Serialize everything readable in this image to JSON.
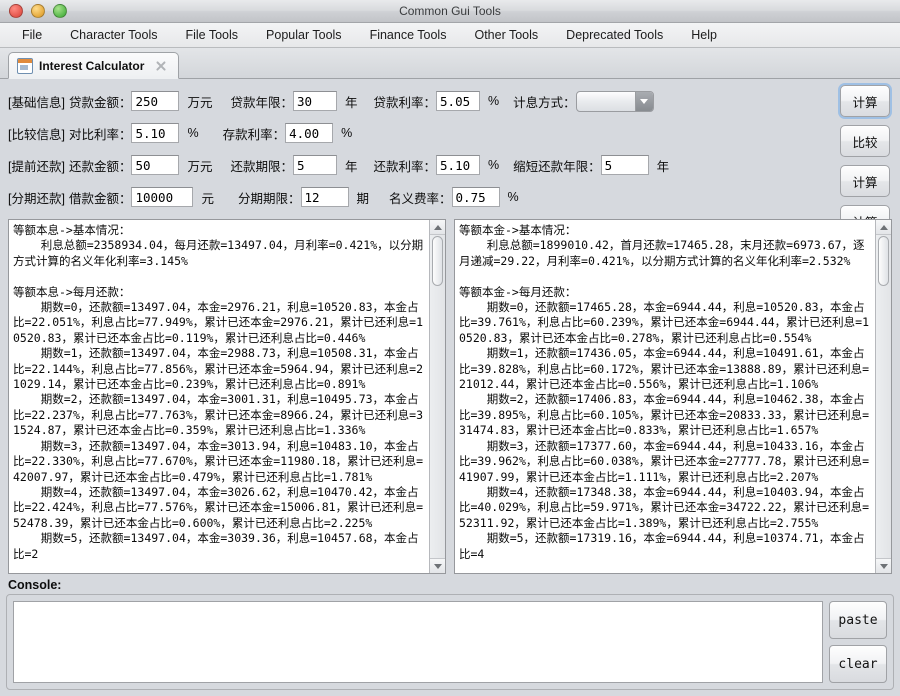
{
  "window": {
    "title": "Common Gui Tools"
  },
  "menubar": {
    "items": [
      "File",
      "Character Tools",
      "File Tools",
      "Popular Tools",
      "Finance Tools",
      "Other Tools",
      "Deprecated Tools",
      "Help"
    ]
  },
  "tabs": [
    {
      "label": "Interest Calculator",
      "icon": "calendar-icon",
      "close": "close-icon"
    }
  ],
  "form": {
    "row1": {
      "group": "[基础信息]",
      "f1_label": "贷款金额：",
      "f1_value": "250",
      "f1_unit": "万元",
      "f2_label": "贷款年限：",
      "f2_value": "30",
      "f2_unit": "年",
      "f3_label": "贷款利率：",
      "f3_value": "5.05",
      "f3_unit": "%",
      "f4_label": "计息方式：",
      "f4_value": "",
      "button": "计算"
    },
    "row2": {
      "group": "[比较信息]",
      "f1_label": "对比利率：",
      "f1_value": "5.10",
      "f1_unit": "%",
      "f2_label": "存款利率：",
      "f2_value": "4.00",
      "f2_unit": "%",
      "button": "比较"
    },
    "row3": {
      "group": "[提前还款]",
      "f1_label": "还款金额：",
      "f1_value": "50",
      "f1_unit": "万元",
      "f2_label": "还款期限：",
      "f2_value": "5",
      "f2_unit": "年",
      "f3_label": "还款利率：",
      "f3_value": "5.10",
      "f3_unit": "%",
      "f4_label": "缩短还款年限：",
      "f4_value": "5",
      "f4_unit": "年",
      "button": "计算"
    },
    "row4": {
      "group": "[分期还款]",
      "f1_label": "借款金额：",
      "f1_value": "10000",
      "f1_unit": "元",
      "f2_label": "分期期限：",
      "f2_value": "12",
      "f2_unit": "期",
      "f3_label": "名义费率：",
      "f3_value": "0.75",
      "f3_unit": "%",
      "button": "计算"
    }
  },
  "panes": {
    "left": {
      "text": "等额本息->基本情况：\n    利息总额=2358934.04，每月还款=13497.04，月利率=0.421%，以分期方式计算的名义年化利率=3.145%\n\n等额本息->每月还款：\n    期数=0，还款额=13497.04，本金=2976.21，利息=10520.83，本金占比=22.051%，利息占比=77.949%，累计已还本金=2976.21，累计已还利息=10520.83，累计已还本金占比=0.119%，累计已还利息占比=0.446%\n    期数=1，还款额=13497.04，本金=2988.73，利息=10508.31，本金占比=22.144%，利息占比=77.856%，累计已还本金=5964.94，累计已还利息=21029.14，累计已还本金占比=0.239%，累计已还利息占比=0.891%\n    期数=2，还款额=13497.04，本金=3001.31，利息=10495.73，本金占比=22.237%，利息占比=77.763%，累计已还本金=8966.24，累计已还利息=31524.87，累计已还本金占比=0.359%，累计已还利息占比=1.336%\n    期数=3，还款额=13497.04，本金=3013.94，利息=10483.10，本金占比=22.330%，利息占比=77.670%，累计已还本金=11980.18，累计已还利息=42007.97，累计已还本金占比=0.479%，累计已还利息占比=1.781%\n    期数=4，还款额=13497.04，本金=3026.62，利息=10470.42，本金占比=22.424%，利息占比=77.576%，累计已还本金=15006.81，累计已还利息=52478.39，累计已还本金占比=0.600%，累计已还利息占比=2.225%\n    期数=5，还款额=13497.04，本金=3039.36，利息=10457.68，本金占比=2"
    },
    "right": {
      "text": "等额本金->基本情况：\n    利息总额=1899010.42，首月还款=17465.28，末月还款=6973.67，逐月递减=29.22，月利率=0.421%，以分期方式计算的名义年化利率=2.532%\n\n等额本金->每月还款：\n    期数=0，还款额=17465.28，本金=6944.44，利息=10520.83，本金占比=39.761%，利息占比=60.239%，累计已还本金=6944.44，累计已还利息=10520.83，累计已还本金占比=0.278%，累计已还利息占比=0.554%\n    期数=1，还款额=17436.05，本金=6944.44，利息=10491.61，本金占比=39.828%，利息占比=60.172%，累计已还本金=13888.89，累计已还利息=21012.44，累计已还本金占比=0.556%，累计已还利息占比=1.106%\n    期数=2，还款额=17406.83，本金=6944.44，利息=10462.38，本金占比=39.895%，利息占比=60.105%，累计已还本金=20833.33，累计已还利息=31474.83，累计已还本金占比=0.833%，累计已还利息占比=1.657%\n    期数=3，还款额=17377.60，本金=6944.44，利息=10433.16，本金占比=39.962%，利息占比=60.038%，累计已还本金=27777.78，累计已还利息=41907.99，累计已还本金占比=1.111%，累计已还利息占比=2.207%\n    期数=4，还款额=17348.38，本金=6944.44，利息=10403.94，本金占比=40.029%，利息占比=59.971%，累计已还本金=34722.22，累计已还利息=52311.92，累计已还本金占比=1.389%，累计已还利息占比=2.755%\n    期数=5，还款额=17319.16，本金=6944.44，利息=10374.71，本金占比=4"
    }
  },
  "console": {
    "label": "Console:",
    "value": "",
    "paste_label": "paste",
    "clear_label": "clear"
  }
}
